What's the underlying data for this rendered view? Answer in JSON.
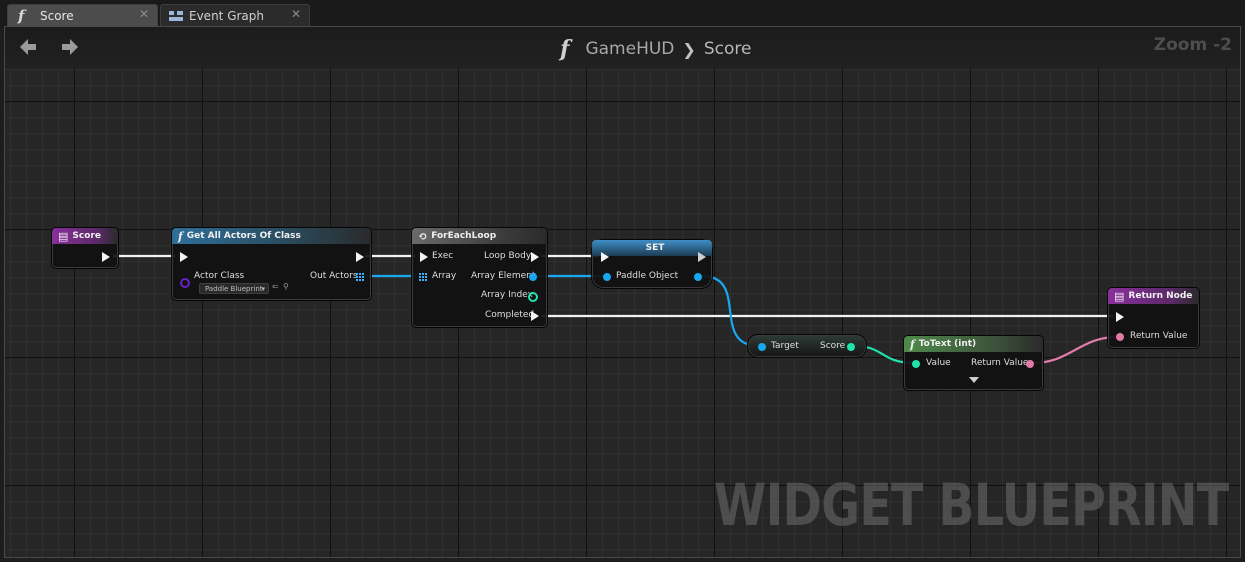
{
  "tabs": [
    {
      "label": "Score",
      "icon": "function-icon",
      "active": true,
      "close": "✕"
    },
    {
      "label": "Event Graph",
      "icon": "event-graph-icon",
      "active": false,
      "close": "✕"
    }
  ],
  "breadcrumb": {
    "icon_glyph": "f",
    "parent": "GameHUD",
    "separator": "❯",
    "current": "Score"
  },
  "zoom": "Zoom -2",
  "watermark": "WIDGET BLUEPRINT",
  "nodes": {
    "score_entry": {
      "title": "Score"
    },
    "get_all_actors": {
      "title": "Get All Actors Of Class",
      "actor_class_label": "Actor Class",
      "actor_class_value": "Paddle Blueprint",
      "out_actors_label": "Out Actors"
    },
    "foreach": {
      "title": "ForEachLoop",
      "exec_label": "Exec",
      "array_label": "Array",
      "loop_body_label": "Loop Body",
      "array_element_label": "Array Element",
      "array_index_label": "Array Index",
      "completed_label": "Completed"
    },
    "set_node": {
      "title": "SET",
      "paddle_object_label": "Paddle Object"
    },
    "score_getter": {
      "target_label": "Target",
      "score_label": "Score"
    },
    "to_text": {
      "title": "ToText (int)",
      "value_label": "Value",
      "return_value_label": "Return Value"
    },
    "return_node": {
      "title": "Return Node",
      "return_value_label": "Return Value"
    }
  },
  "colors": {
    "exec_wire": "#ffffff",
    "object_pin": "#18a8f0",
    "integer_pin": "#1fe3ac",
    "text_pin": "#e07aa8",
    "class_pin": "#5a00b4",
    "function_header_blue": "#2e6f9a",
    "entry_header_purple": "#8a2f9c"
  }
}
